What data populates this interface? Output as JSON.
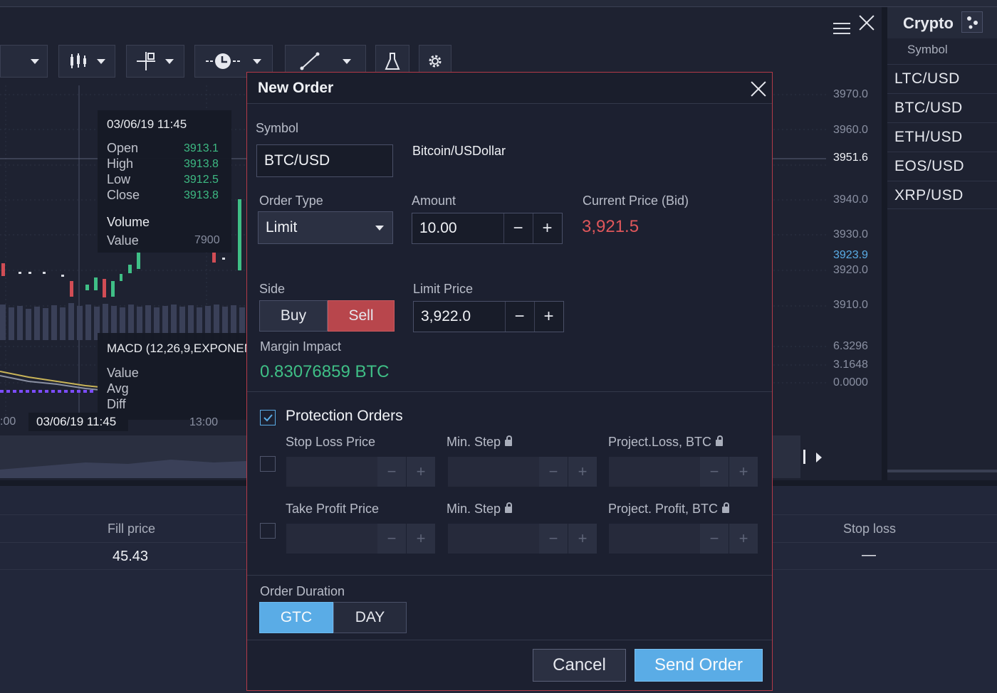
{
  "toolbar": {
    "icons": [
      "chevron-down-icon",
      "candles-icon",
      "crosshair-icon",
      "clock-icon",
      "line-icon",
      "flask-icon",
      "gear-icon"
    ]
  },
  "crosshair": {
    "date": "03/06/19 11:45",
    "open_label": "Open",
    "open_value": "3913.1",
    "high_label": "High",
    "high_value": "3913.8",
    "low_label": "Low",
    "low_value": "3912.5",
    "close_label": "Close",
    "close_value": "3913.8",
    "volume_label": "Volume",
    "value_label": "Value",
    "value_value": "7900"
  },
  "macd": {
    "title": "MACD (12,26,9,EXPONEN",
    "value_label": "Value",
    "avg_label": "Avg",
    "diff_label": "Diff"
  },
  "time_axis": {
    "left_tick": ":00",
    "cursor_label": "03/06/19 11:45",
    "tick_2": "13:00"
  },
  "price_axis": [
    "3970.0",
    "3960.0",
    "3951.6",
    "3940.0",
    "3930.0",
    "3923.9",
    "3920.0",
    "3910.0",
    "6.3296",
    "3.1648",
    "0.0000"
  ],
  "right_panel": {
    "title": "Crypto",
    "subtitle": "Symbol",
    "items": [
      "LTC/USD",
      "BTC/USD",
      "ETH/USD",
      "EOS/USD",
      "XRP/USD"
    ]
  },
  "positions": {
    "fill_price_label": "Fill price",
    "fill_price_value": "45.43",
    "stop_loss_label": "Stop loss",
    "stop_loss_value": "—"
  },
  "dialog": {
    "title": "New Order",
    "symbol_label": "Symbol",
    "symbol_value": "BTC/USD",
    "symbol_desc": "Bitcoin/USDollar",
    "order_type_label": "Order Type",
    "order_type_value": "Limit",
    "amount_label": "Amount",
    "amount_value": "10.00",
    "current_price_label": "Current Price (Bid)",
    "current_price_value": "3,921.5",
    "side_label": "Side",
    "buy_label": "Buy",
    "sell_label": "Sell",
    "limit_price_label": "Limit Price",
    "limit_price_value": "3,922.0",
    "margin_label": "Margin Impact",
    "margin_value": "0.83076859 BTC",
    "protection_label": "Protection Orders",
    "stop_loss_label": "Stop Loss Price",
    "min_step_label": "Min. Step",
    "project_loss_label": "Project.Loss, BTC",
    "take_profit_label": "Take Profit Price",
    "min_step_label_2": "Min. Step",
    "project_profit_label": "Project. Profit, BTC",
    "duration_label": "Order Duration",
    "gtc_label": "GTC",
    "day_label": "DAY",
    "cancel_label": "Cancel",
    "send_label": "Send Order",
    "minus": "−",
    "plus": "+"
  },
  "colors": {
    "accent_blue": "#5aace6",
    "sell_red": "#b8464c",
    "price_red": "#e0575b",
    "margin_green": "#3fbf86"
  }
}
